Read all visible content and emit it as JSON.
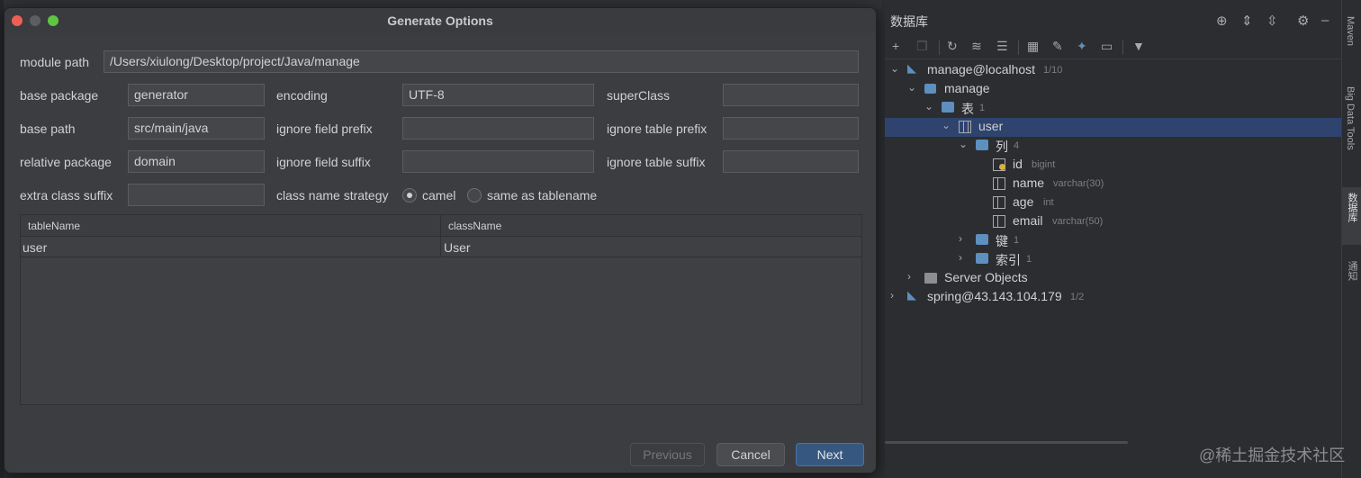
{
  "dialog": {
    "title": "Generate Options",
    "fields": {
      "module_path": {
        "label": "module path",
        "value": "/Users/xiulong/Desktop/project/Java/manage"
      },
      "base_package": {
        "label": "base package",
        "value": "generator"
      },
      "encoding": {
        "label": "encoding",
        "value": "UTF-8"
      },
      "super_class": {
        "label": "superClass",
        "value": ""
      },
      "base_path": {
        "label": "base path",
        "value": "src/main/java"
      },
      "ignore_field_prefix": {
        "label": "ignore field prefix",
        "value": ""
      },
      "ignore_table_prefix": {
        "label": "ignore table prefix",
        "value": ""
      },
      "relative_package": {
        "label": "relative package",
        "value": "domain"
      },
      "ignore_field_suffix": {
        "label": "ignore field suffix",
        "value": ""
      },
      "ignore_table_suffix": {
        "label": "ignore table suffix",
        "value": ""
      },
      "extra_class_suffix": {
        "label": "extra class suffix",
        "value": ""
      }
    },
    "class_name_strategy": {
      "label": "class name strategy",
      "options": [
        "camel",
        "same as tablename"
      ],
      "selected": "camel"
    },
    "table": {
      "columns": [
        "tableName",
        "className"
      ],
      "rows": [
        [
          "user",
          "User"
        ]
      ]
    },
    "buttons": {
      "previous": "Previous",
      "cancel": "Cancel",
      "next": "Next"
    }
  },
  "db_panel": {
    "title": "数据库",
    "tree": {
      "conn1": {
        "label": "manage@localhost",
        "meta": "1/10"
      },
      "schema": {
        "label": "manage"
      },
      "tables_folder": {
        "label": "表",
        "meta": "1"
      },
      "table_user": {
        "label": "user"
      },
      "columns_folder": {
        "label": "列",
        "meta": "4"
      },
      "col_id": {
        "label": "id",
        "meta": "bigint"
      },
      "col_name": {
        "label": "name",
        "meta": "varchar(30)"
      },
      "col_age": {
        "label": "age",
        "meta": "int"
      },
      "col_email": {
        "label": "email",
        "meta": "varchar(50)"
      },
      "keys_folder": {
        "label": "键",
        "meta": "1"
      },
      "index_folder": {
        "label": "索引",
        "meta": "1"
      },
      "server_objects": {
        "label": "Server Objects"
      },
      "conn2": {
        "label": "spring@43.143.104.179",
        "meta": "1/2"
      }
    }
  },
  "side_strip": {
    "maven": "Maven",
    "big_data_tools": "Big Data Tools",
    "database": "数据库",
    "notifications": "通知"
  },
  "watermark": "@稀土掘金技术社区",
  "colors": {
    "accent": "#365880",
    "selection": "#2e436e",
    "folder": "#5d8fbf"
  }
}
